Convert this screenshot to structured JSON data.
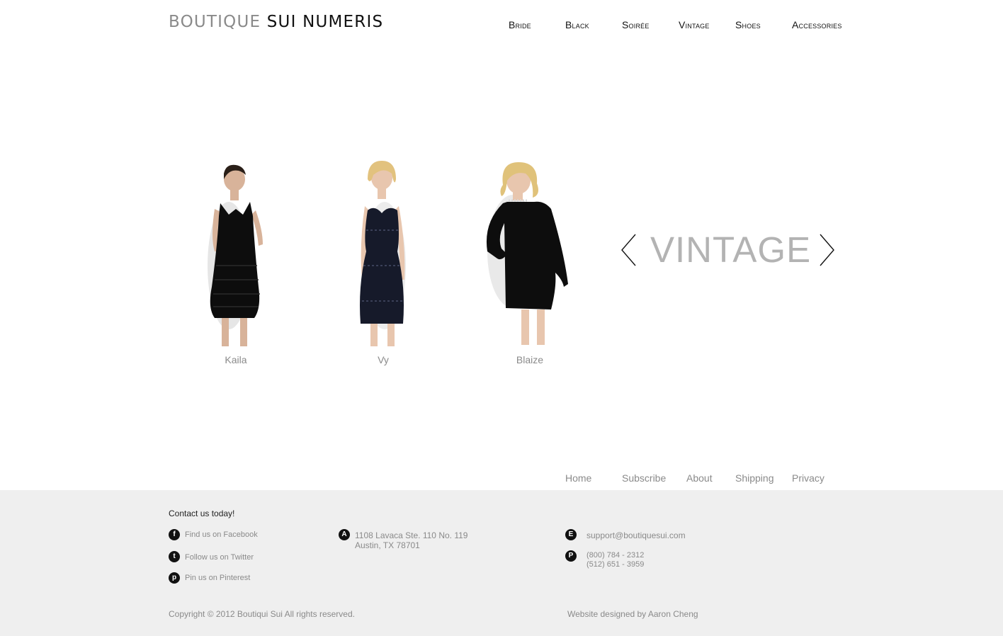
{
  "header": {
    "logo_part1": "BOUTIQUE",
    "logo_part2": "SUI NUMERIS"
  },
  "nav": [
    "Bride",
    "Black",
    "Soirée",
    "Vintage",
    "Shoes",
    "Accessories"
  ],
  "gallery": {
    "collection_title": "VINTAGE",
    "items": [
      {
        "name": "Kaila"
      },
      {
        "name": "Vy"
      },
      {
        "name": "Blaize"
      }
    ]
  },
  "footer_nav": [
    "Home",
    "Subscribe",
    "About",
    "Shipping",
    "Privacy"
  ],
  "footer": {
    "contact_title": "Contact us today!",
    "social": [
      {
        "icon": "facebook-icon",
        "glyph": "f",
        "label": "Find us on Facebook"
      },
      {
        "icon": "twitter-icon",
        "glyph": "t",
        "label": "Follow us on Twitter"
      },
      {
        "icon": "pinterest-icon",
        "glyph": "p",
        "label": "Pin us on Pinterest"
      }
    ],
    "address": {
      "icon": "address-icon",
      "glyph": "A",
      "line1": "1108 Lavaca Ste. 110 No. 119",
      "line2": "Austin, TX 78701"
    },
    "email": {
      "icon": "email-icon",
      "glyph": "E",
      "value": "support@boutiquesui.com"
    },
    "phone": {
      "icon": "phone-icon",
      "glyph": "P",
      "line1": "(800) 784 - 2312",
      "line2": "(512) 651 - 3959"
    },
    "copyright": "Copyright © 2012 Boutiqui Sui All rights reserved.",
    "credit": "Website designed by  Aaron Cheng"
  }
}
